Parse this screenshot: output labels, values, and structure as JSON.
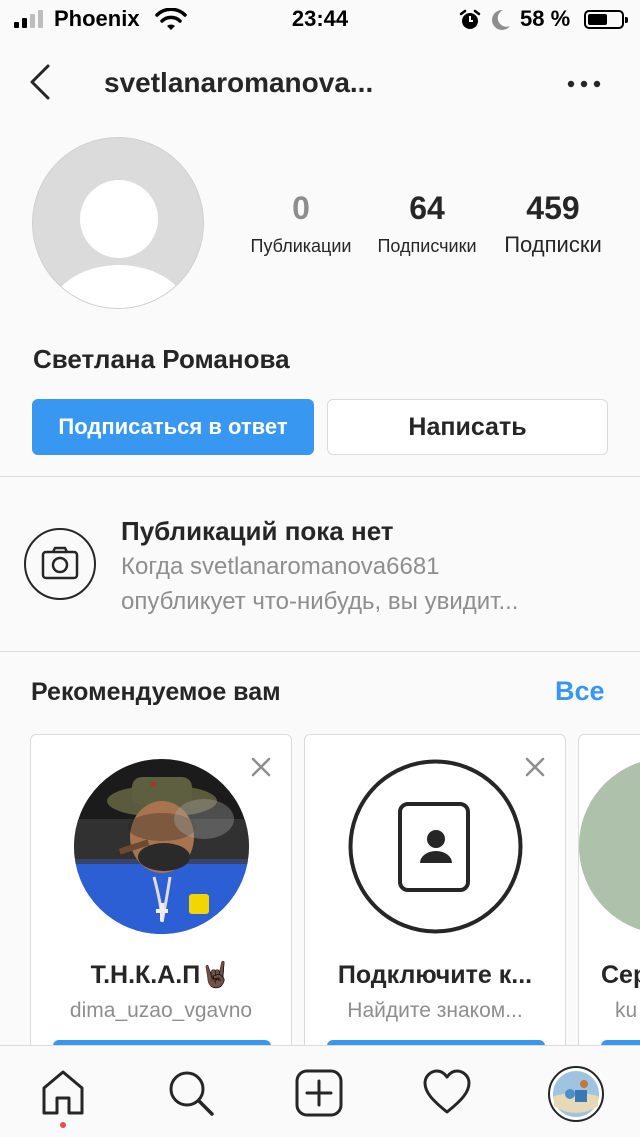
{
  "status_bar": {
    "carrier": "Phoenix",
    "time": "23:44",
    "battery_percent": "58 %",
    "battery_level": 0.58,
    "icons": [
      "signal-icon",
      "wifi-icon",
      "alarm-icon",
      "moon-icon",
      "battery-icon"
    ]
  },
  "header": {
    "username": "svetlanaromanova..."
  },
  "profile": {
    "full_name": "Светлана Романова",
    "stats": [
      {
        "value": "0",
        "label": "Публикации"
      },
      {
        "value": "64",
        "label": "Подписчики"
      },
      {
        "value": "459",
        "label": "Подписки"
      }
    ],
    "follow_back_label": "Подписаться в ответ",
    "message_label": "Написать"
  },
  "no_posts": {
    "title": "Публикаций пока нет",
    "line1": "Когда svetlanaromanova6681",
    "line2": "опубликует что-нибудь, вы увидит..."
  },
  "suggested": {
    "title": "Рекомендуемое вам",
    "see_all": "Все",
    "cards": [
      {
        "name": "Т.Н.К.А.П🤘🏿",
        "sub": "dima_uzao_vgavno"
      },
      {
        "name": "Подключите к...",
        "sub": "Найдите знаком..."
      },
      {
        "name": "Сер",
        "sub": "ku"
      }
    ]
  },
  "nav": {
    "items": [
      "home-icon",
      "search-icon",
      "add-post-icon",
      "heart-icon",
      "profile-avatar"
    ]
  },
  "colors": {
    "accent": "#3897f0",
    "text": "#262626",
    "secondary": "#8e8e8e",
    "notification_dot": "#ed4956"
  }
}
